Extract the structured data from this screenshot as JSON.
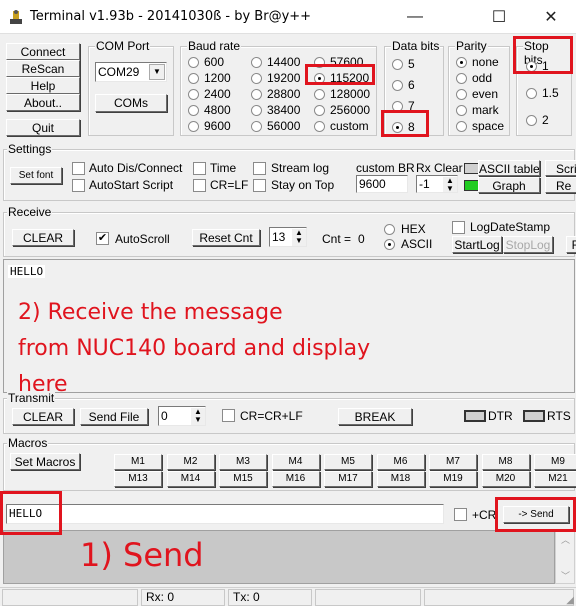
{
  "window": {
    "title": "Terminal v1.93b - 20141030ß - by Br@y++",
    "minimize": "—",
    "maximize": "☐",
    "close": "✕"
  },
  "side_buttons": {
    "connect": "Connect",
    "rescan": "ReScan",
    "help": "Help",
    "about": "About..",
    "quit": "Quit"
  },
  "com_port": {
    "legend": "COM Port",
    "selected": "COM29",
    "coms_button": "COMs"
  },
  "baud_rate": {
    "legend": "Baud rate",
    "options": [
      "600",
      "1200",
      "2400",
      "4800",
      "9600",
      "14400",
      "19200",
      "28800",
      "38400",
      "56000",
      "57600",
      "115200",
      "128000",
      "256000",
      "custom"
    ],
    "selected": "115200"
  },
  "data_bits": {
    "legend": "Data bits",
    "options": [
      "5",
      "6",
      "7",
      "8"
    ],
    "selected": "8"
  },
  "parity": {
    "legend": "Parity",
    "options": [
      "none",
      "odd",
      "even",
      "mark",
      "space"
    ],
    "selected": "none"
  },
  "stop_bits": {
    "legend": "Stop bits",
    "options": [
      "1",
      "1.5",
      "2"
    ],
    "selected": "1"
  },
  "settings": {
    "legend": "Settings",
    "set_font": "Set font",
    "checkboxes": {
      "auto_dis_connect": "Auto Dis/Connect",
      "autostart_script": "AutoStart Script",
      "time": "Time",
      "cr_lf": "CR=LF",
      "stream_log": "Stream log",
      "stay_on_top": "Stay on Top"
    },
    "custom_br_label": "custom BR",
    "custom_br_value": "9600",
    "rx_clear_label": "Rx Clear",
    "rx_clear_value": "-1",
    "ascii_table": "ASCII table",
    "graph": "Graph",
    "scripting": "Scri",
    "remote": "Re"
  },
  "receive": {
    "legend": "Receive",
    "clear": "CLEAR",
    "autoscroll": "AutoScroll",
    "autoscroll_checked": true,
    "reset_cnt": "Reset Cnt",
    "cnt_spin": "13",
    "cnt_label": "Cnt =",
    "cnt_value": "0",
    "hex": "HEX",
    "ascii": "ASCII",
    "mode": "ASCII",
    "log_date_stamp": "LogDateStamp",
    "start_log": "StartLog",
    "stop_log": "StopLog",
    "extra": "R",
    "text": "HELLO"
  },
  "transmit": {
    "legend": "Transmit",
    "clear": "CLEAR",
    "send_file": "Send File",
    "spin_value": "0",
    "cr_crlf": "CR=CR+LF",
    "break": "BREAK",
    "dtr": "DTR",
    "rts": "RTS"
  },
  "macros": {
    "legend": "Macros",
    "set_macros": "Set Macros",
    "row1": [
      "M1",
      "M2",
      "M3",
      "M4",
      "M5",
      "M6",
      "M7",
      "M8",
      "M9"
    ],
    "row2": [
      "M13",
      "M14",
      "M15",
      "M16",
      "M17",
      "M18",
      "M19",
      "M20",
      "M21"
    ]
  },
  "send_bar": {
    "input_value": "HELLO",
    "plus_cr": "+CR",
    "send": "-> Send"
  },
  "status_bar": {
    "rx": "Rx: 0",
    "tx": "Tx: 0"
  },
  "annotations": {
    "receive": [
      "2) Receive the message",
      "from NUC140 board and display",
      "here"
    ],
    "send": "1) Send",
    "color": "#e0141e"
  }
}
